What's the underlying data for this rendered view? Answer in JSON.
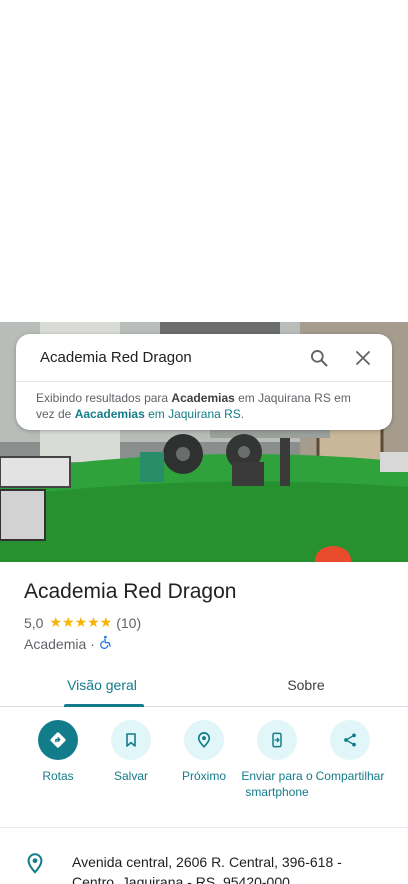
{
  "search": {
    "query": "Academia Red Dragon",
    "note_prefix": "Exibindo resultados para ",
    "note_bold": "Academias",
    "note_middle": " em Jaquirana RS em vez de ",
    "note_link_bold": "Aacademias",
    "note_link_rest": " em Jaquirana RS",
    "note_end": "."
  },
  "place": {
    "title": "Academia Red Dragon",
    "rating": "5,0",
    "stars": "★★★★★",
    "reviews": "(10)",
    "category": "Academia",
    "separator": "·"
  },
  "tabs": [
    {
      "label": "Visão geral"
    },
    {
      "label": "Sobre"
    }
  ],
  "actions": [
    {
      "label": "Rotas",
      "icon": "directions-icon"
    },
    {
      "label": "Salvar",
      "icon": "bookmark-icon"
    },
    {
      "label": "Próximo",
      "icon": "nearby-icon"
    },
    {
      "label": "Enviar para o smartphone",
      "icon": "send-to-phone-icon"
    },
    {
      "label": "Compartilhar",
      "icon": "share-icon"
    }
  ],
  "address": {
    "text": "Avenida central, 2606 R. Central, 396-618 - Centro, Jaquirana - RS, 95420-000"
  },
  "colors": {
    "accent": "#137c8a",
    "accent_light": "#e0f6f8",
    "star": "#f4b400"
  }
}
